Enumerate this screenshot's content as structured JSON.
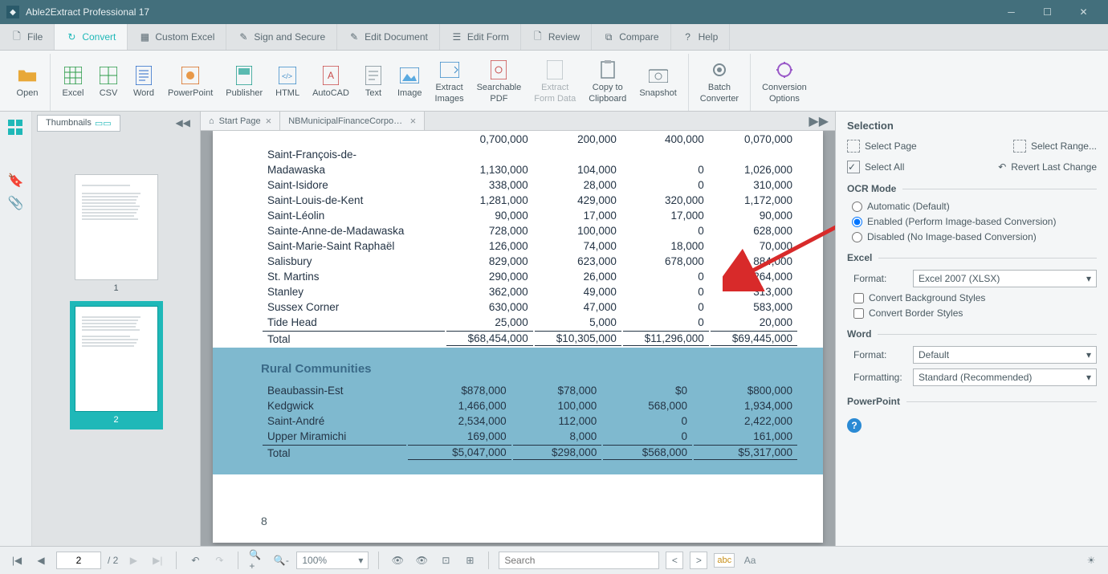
{
  "titlebar": {
    "app": "Able2Extract Professional 17"
  },
  "menu": {
    "file": "File",
    "convert": "Convert",
    "customExcel": "Custom Excel",
    "signSecure": "Sign and Secure",
    "editDoc": "Edit Document",
    "editForm": "Edit Form",
    "review": "Review",
    "compare": "Compare",
    "help": "Help"
  },
  "ribbon": {
    "open": "Open",
    "excel": "Excel",
    "csv": "CSV",
    "word": "Word",
    "powerpoint": "PowerPoint",
    "publisher": "Publisher",
    "html": "HTML",
    "autocad": "AutoCAD",
    "text": "Text",
    "image": "Image",
    "extractImages": "Extract\nImages",
    "searchablePdf": "Searchable\nPDF",
    "extractFormData": "Extract\nForm Data",
    "copyClipboard": "Copy to\nClipboard",
    "snapshot": "Snapshot",
    "batchConverter": "Batch\nConverter",
    "conversionOptions": "Conversion\nOptions"
  },
  "thumbs": {
    "tab": "Thumbnails",
    "p1": "1",
    "p2": "2"
  },
  "tabs": {
    "start": "Start Page",
    "doc": "NBMunicipalFinanceCorporation..."
  },
  "doc": {
    "rows1": [
      [
        "Saint-François-de-",
        "",
        "",
        "",
        ""
      ],
      [
        "Madawaska",
        "1,130,000",
        "104,000",
        "0",
        "1,026,000"
      ],
      [
        "Saint-Isidore",
        "338,000",
        "28,000",
        "0",
        "310,000"
      ],
      [
        "Saint-Louis-de-Kent",
        "1,281,000",
        "429,000",
        "320,000",
        "1,172,000"
      ],
      [
        "Saint-Léolin",
        "90,000",
        "17,000",
        "17,000",
        "90,000"
      ],
      [
        "Sainte-Anne-de-Madawaska",
        "728,000",
        "100,000",
        "0",
        "628,000"
      ],
      [
        "Saint-Marie-Saint Raphaël",
        "126,000",
        "74,000",
        "18,000",
        "70,000"
      ],
      [
        "Salisbury",
        "829,000",
        "623,000",
        "678,000",
        "884,000"
      ],
      [
        "St. Martins",
        "290,000",
        "26,000",
        "0",
        "264,000"
      ],
      [
        "Stanley",
        "362,000",
        "49,000",
        "0",
        "313,000"
      ],
      [
        "Sussex Corner",
        "630,000",
        "47,000",
        "0",
        "583,000"
      ],
      [
        "Tide Head",
        "25,000",
        "5,000",
        "0",
        "20,000"
      ]
    ],
    "total1": [
      "Total",
      "$68,454,000",
      "$10,305,000",
      "$11,296,000",
      "$69,445,000"
    ],
    "cutoff": [
      "",
      "0,700,000",
      "200,000",
      "400,000",
      "0,070,000"
    ],
    "sect2": "Rural Communities",
    "rows2": [
      [
        "Beaubassin-Est",
        "$878,000",
        "$78,000",
        "$0",
        "$800,000"
      ],
      [
        "Kedgwick",
        "1,466,000",
        "100,000",
        "568,000",
        "1,934,000"
      ],
      [
        "Saint-André",
        "2,534,000",
        "112,000",
        "0",
        "2,422,000"
      ],
      [
        "Upper Miramichi",
        "169,000",
        "8,000",
        "0",
        "161,000"
      ]
    ],
    "total2": [
      "Total",
      "$5,047,000",
      "$298,000",
      "$568,000",
      "$5,317,000"
    ],
    "pagenum": "8"
  },
  "rp": {
    "selection": "Selection",
    "selPage": "Select Page",
    "selRange": "Select Range...",
    "selAll": "Select All",
    "revert": "Revert Last Change",
    "ocr": "OCR Mode",
    "ocrAuto": "Automatic (Default)",
    "ocrEnabled": "Enabled (Perform Image-based Conversion)",
    "ocrDisabled": "Disabled (No Image-based Conversion)",
    "excel": "Excel",
    "format": "Format:",
    "excelFmt": "Excel 2007 (XLSX)",
    "convBg": "Convert Background Styles",
    "convBorder": "Convert Border Styles",
    "word": "Word",
    "wordFmt": "Default",
    "formatting": "Formatting:",
    "wordFormatting": "Standard (Recommended)",
    "ppt": "PowerPoint"
  },
  "status": {
    "page": "2",
    "pages": "/  2",
    "zoom": "100%",
    "search": "Search",
    "abc": "abc",
    "aa": "Aa"
  }
}
